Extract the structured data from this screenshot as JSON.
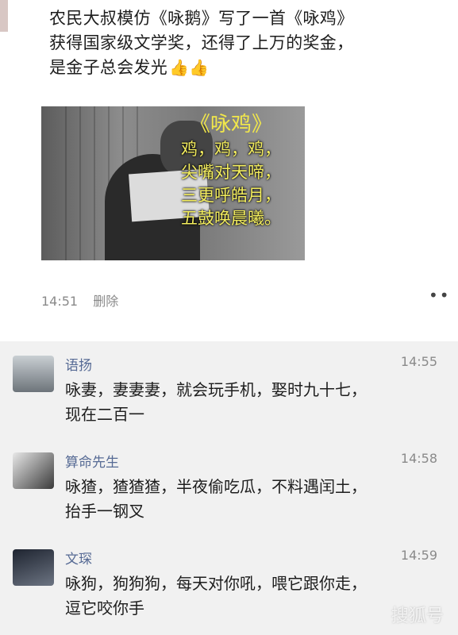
{
  "post": {
    "lines": [
      "农民大叔模仿《咏鹅》写了一首《咏鸡》",
      "获得国家级文学奖，还得了上万的奖金，",
      "是金子总会发光"
    ],
    "emoji": "👍👍",
    "poem": {
      "title": "《咏鸡》",
      "lines": [
        "鸡，鸡，鸡，",
        "尖嘴对天啼，",
        "三更呼皓月，",
        "五鼓唤晨曦。"
      ]
    },
    "time": "14:51",
    "delete_label": "删除",
    "more_label": "••"
  },
  "comments": [
    {
      "name": "语扬",
      "time": "14:55",
      "lines": [
        "咏妻，妻妻妻，就会玩手机，娶时九十七，",
        "现在二百一"
      ]
    },
    {
      "name": "算命先生",
      "time": "14:58",
      "lines": [
        "咏猹，猹猹猹，半夜偷吃瓜，不料遇闰土，",
        "抬手一钢叉"
      ]
    },
    {
      "name": "文琛",
      "time": "14:59",
      "lines": [
        "咏狗，狗狗狗，每天对你吼，喂它跟你走，",
        "逗它咬你手"
      ]
    }
  ],
  "watermark": "搜狐号"
}
